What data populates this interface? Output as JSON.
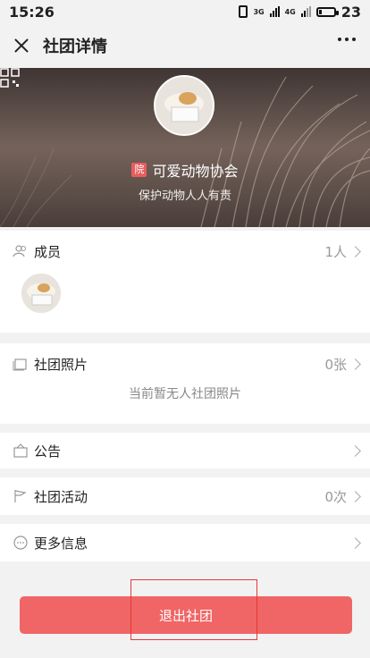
{
  "status_bar": {
    "time": "15:26",
    "signal1_label": "3G",
    "signal2_label": "4G",
    "battery": "23",
    "battery_level": 0.23
  },
  "header": {
    "title": "社团详情",
    "close_icon": "close-icon",
    "more_icon": "more-icon"
  },
  "club": {
    "badge": "院",
    "name": "可爱动物协会",
    "motto": "保护动物人人有责"
  },
  "members": {
    "label": "成员",
    "value": "1人"
  },
  "photos": {
    "label": "社团照片",
    "value": "0张",
    "empty": "当前暂无人社团照片"
  },
  "notice": {
    "label": "公告"
  },
  "activities": {
    "label": "社团活动",
    "value": "0次"
  },
  "more_info": {
    "label": "更多信息"
  },
  "exit_button": "退出社团",
  "colors": {
    "accent": "#f06565",
    "badge": "#e85d5d",
    "highlight": "#e53935"
  }
}
